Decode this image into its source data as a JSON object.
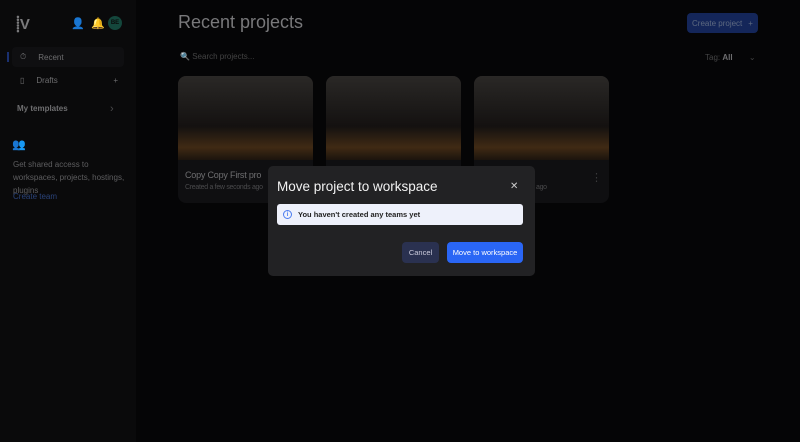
{
  "sidebar": {
    "logo": "⸽V",
    "avatar": "BE",
    "nav": [
      {
        "label": "Recent"
      },
      {
        "label": "Drafts"
      }
    ],
    "templates": "My templates",
    "help": "Get shared access to workspaces, projects, hostings, plugins",
    "create_team": "Create team"
  },
  "header": {
    "title": "Recent projects",
    "create": "Create project",
    "search_placeholder": "Search projects...",
    "tag_label": "Tag:",
    "tag_value": "All"
  },
  "cards": [
    {
      "title": "Copy Copy First pro",
      "sub": "Created a few seconds ago"
    },
    {
      "title": "",
      "sub": ""
    },
    {
      "title": "",
      "sub": "ago"
    }
  ],
  "modal": {
    "title": "Move project to workspace",
    "info": "You haven't created any teams yet",
    "cancel": "Cancel",
    "confirm": "Move to workspace"
  }
}
